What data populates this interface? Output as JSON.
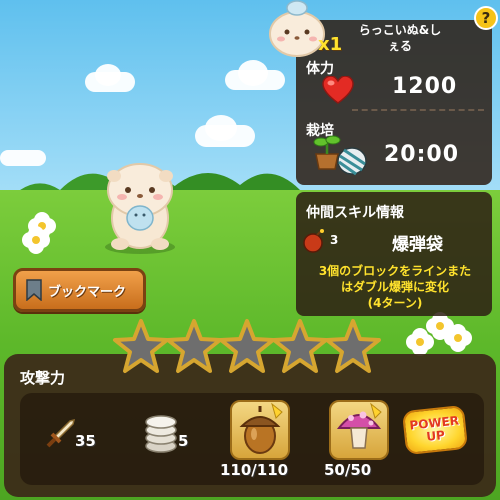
{
  "character": {
    "name": "らっこいぬ&しぇる",
    "count": "x1"
  },
  "status": {
    "stamina_label": "体力",
    "stamina_value": "1200",
    "cultivation_label": "栽培",
    "cultivation_time": "20:00"
  },
  "skill": {
    "header": "仲間スキル情報",
    "level": "3",
    "name": "爆弾袋",
    "description_line1": "3個のブロックをラインまた",
    "description_line2": "はダブル爆弾に変化",
    "description_line3": "(4ターン)"
  },
  "bookmark_label": "ブックマーク",
  "help_label": "?",
  "stars": {
    "filled": 0,
    "total": 5
  },
  "attack": {
    "label": "攻撃力",
    "sword_value": "35",
    "coin_value": "5",
    "acorn_value": "110/110",
    "mushroom_value": "50/50",
    "powerup_line1": "POWER",
    "powerup_line2": "UP"
  },
  "colors": {
    "accent_yellow": "#ffe22d",
    "panel_dark": "#2d1e14",
    "grass": "#5db82a"
  },
  "icons": {
    "heart": "heart-icon",
    "sprout": "sprout-icon",
    "bomb": "bomb-icon",
    "sword": "sword-icon",
    "coin_stack": "coin-stack-icon",
    "acorn": "acorn-icon",
    "mushroom": "mushroom-icon",
    "bookmark": "bookmark-icon"
  }
}
